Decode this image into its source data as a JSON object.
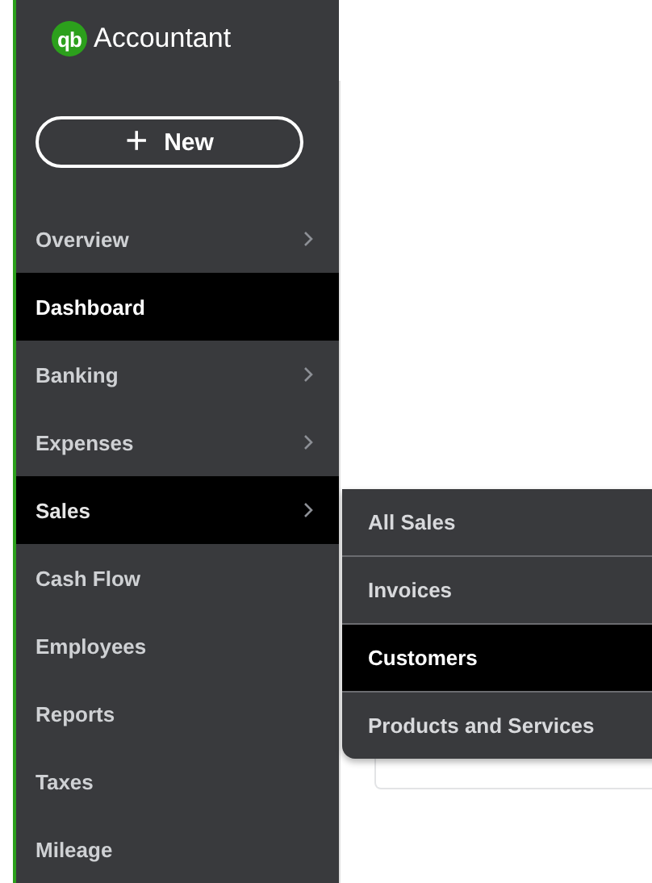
{
  "brand": {
    "mark": "qb",
    "name": "Accountant"
  },
  "new_button": {
    "icon": "+",
    "label": "New"
  },
  "sidebar": {
    "items": [
      {
        "label": "Overview",
        "chevron": true,
        "selected": false,
        "expanded": false
      },
      {
        "label": "Dashboard",
        "chevron": false,
        "selected": true,
        "expanded": false
      },
      {
        "label": "Banking",
        "chevron": true,
        "selected": false,
        "expanded": false
      },
      {
        "label": "Expenses",
        "chevron": true,
        "selected": false,
        "expanded": false
      },
      {
        "label": "Sales",
        "chevron": true,
        "selected": false,
        "expanded": true
      },
      {
        "label": "Cash Flow",
        "chevron": false,
        "selected": false,
        "expanded": false
      },
      {
        "label": "Employees",
        "chevron": false,
        "selected": false,
        "expanded": false
      },
      {
        "label": "Reports",
        "chevron": false,
        "selected": false,
        "expanded": false
      },
      {
        "label": "Taxes",
        "chevron": false,
        "selected": false,
        "expanded": false
      },
      {
        "label": "Mileage",
        "chevron": false,
        "selected": false,
        "expanded": false
      }
    ]
  },
  "submenu": {
    "items": [
      {
        "label": "All Sales",
        "selected": false
      },
      {
        "label": "Invoices",
        "selected": false
      },
      {
        "label": "Customers",
        "selected": true
      },
      {
        "label": "Products and Services",
        "selected": false
      }
    ]
  }
}
